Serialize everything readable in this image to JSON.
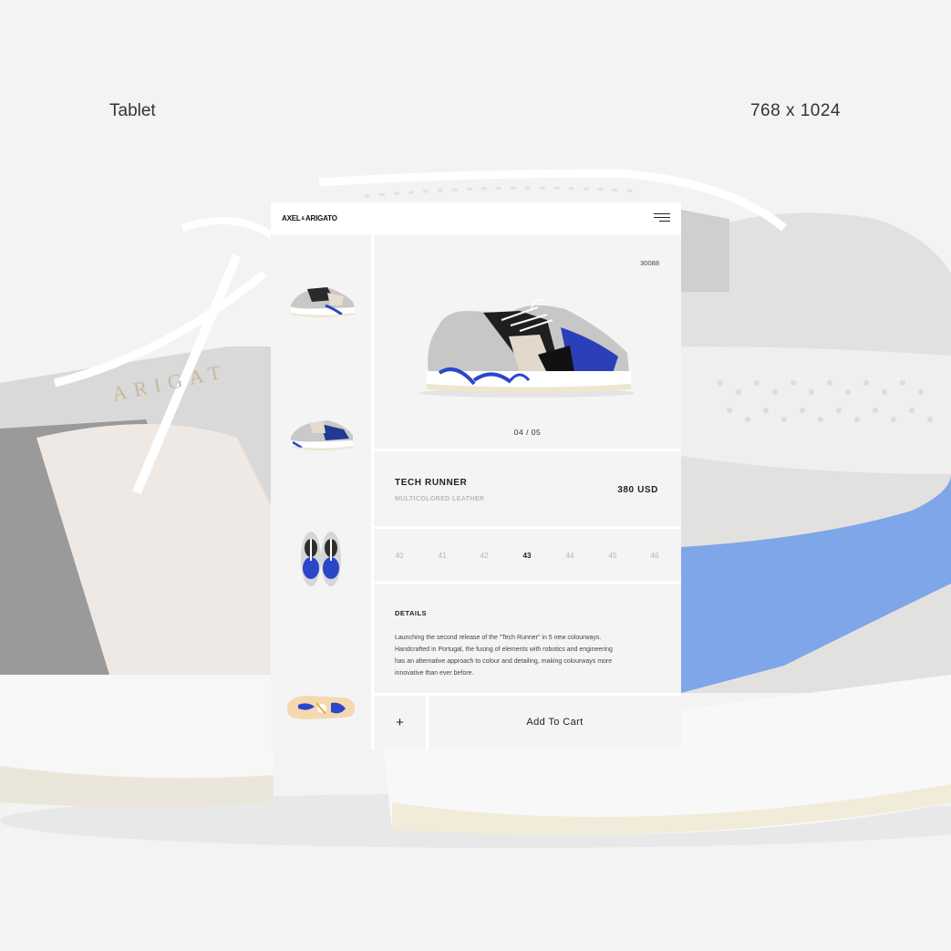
{
  "captions": {
    "device": "Tablet",
    "resolution": "768 x 1024"
  },
  "background": {
    "watermark_text": "ARIGAT"
  },
  "app": {
    "logo": "AXEL ARIGATO",
    "logo_small": "&"
  },
  "thumbnails": [
    {
      "view": "side",
      "label": "side-view"
    },
    {
      "view": "side-blue",
      "label": "side-view-2"
    },
    {
      "view": "top",
      "label": "top-view"
    },
    {
      "view": "sole",
      "label": "sole-view"
    }
  ],
  "hero": {
    "sku": "30088",
    "pager": "04 / 05"
  },
  "product": {
    "name": "TECH RUNNER",
    "subtitle": "MULTICOLORED LEATHER",
    "price": "380 USD"
  },
  "sizes": {
    "options": [
      "40",
      "41",
      "42",
      "43",
      "44",
      "45",
      "46"
    ],
    "selected": "43"
  },
  "details": {
    "title": "DETAILS",
    "text": "Launching the second release of the \"Tech Runner\" in 5 new colourways. Handcrafted in Portugal, the fusing of elements with robotics and engineering has an alternative approach to colour and detailing, making colourways more innovative than ever before."
  },
  "cart": {
    "plus_label": "+",
    "add_label": "Add To Cart"
  },
  "colors": {
    "page_bg": "#f3f3f3",
    "panel_bg": "#f4f4f4",
    "accent_blue": "#2a47c9",
    "sole_cream": "#efe6cf"
  }
}
